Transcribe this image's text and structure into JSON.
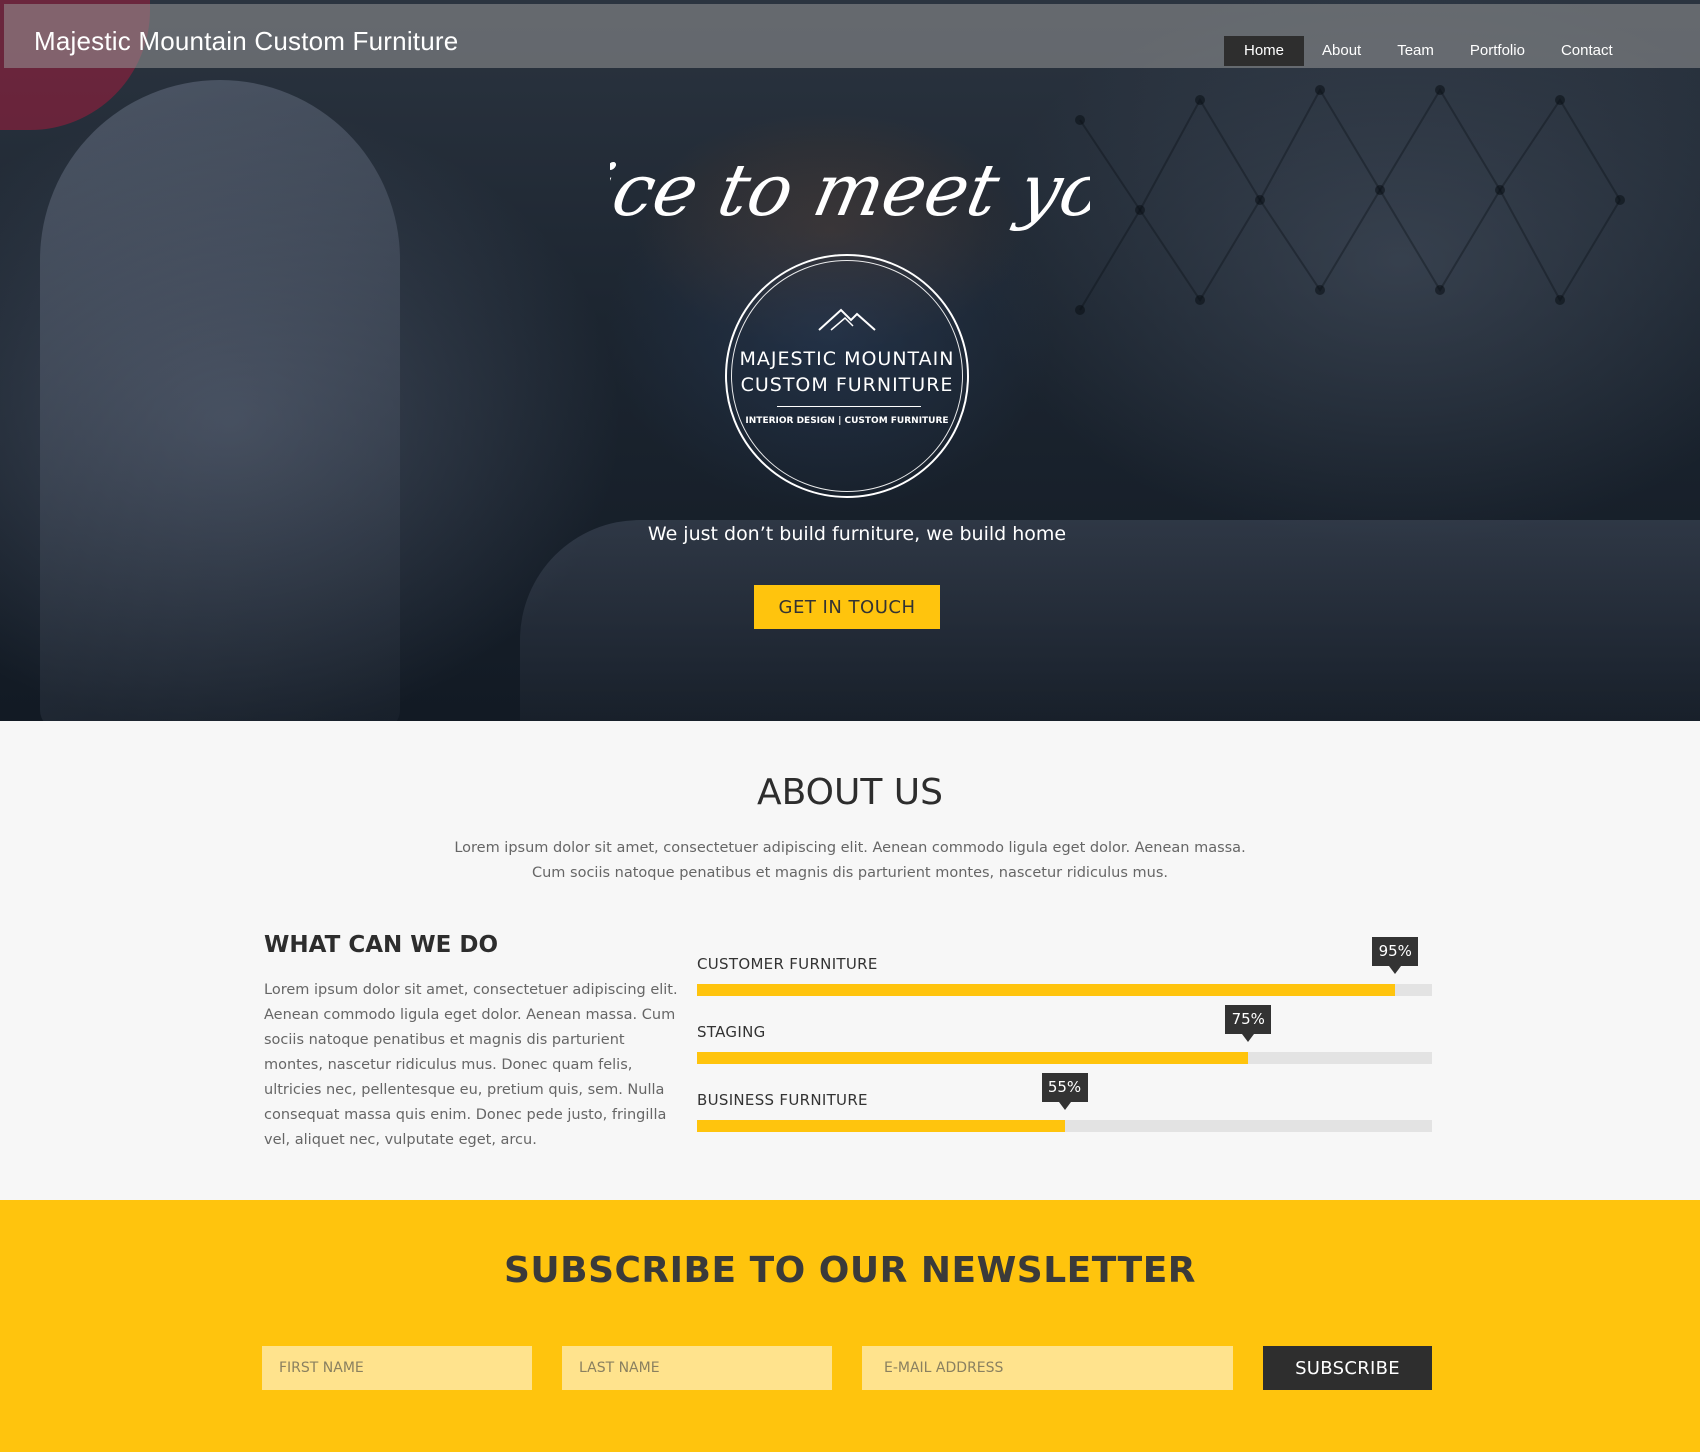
{
  "header": {
    "brand": "Majestic Mountain Custom Furniture",
    "nav": [
      {
        "label": "Home",
        "active": true
      },
      {
        "label": "About",
        "active": false
      },
      {
        "label": "Team",
        "active": false
      },
      {
        "label": "Portfolio",
        "active": false
      },
      {
        "label": "Contact",
        "active": false
      }
    ]
  },
  "hero": {
    "script_heading": "Nice to meet you!",
    "logo": {
      "line1": "MAJESTIC MOUNTAIN",
      "line2": "CUSTOM FURNITURE",
      "subline": "INTERIOR DESIGN | CUSTOM FURNITURE",
      "icon": "mountain-icon"
    },
    "tagline": "We just don’t build furniture, we build home",
    "cta_label": "GET IN TOUCH"
  },
  "about": {
    "title": "ABOUT US",
    "text": "Lorem ipsum dolor sit amet, consectetuer adipiscing elit. Aenean commodo ligula eget dolor. Aenean massa. Cum sociis natoque penatibus et magnis dis parturient montes, nascetur ridiculus mus.",
    "what_title": "WHAT CAN WE DO",
    "what_text": "Lorem ipsum dolor sit amet, consectetuer adipiscing elit. Aenean commodo ligula eget dolor. Aenean massa. Cum sociis natoque penatibus et magnis dis parturient montes, nascetur ridiculus mus. Donec quam felis, ultricies nec, pellentesque eu, pretium quis, sem. Nulla consequat massa quis enim. Donec pede justo, fringilla vel, aliquet nec, vulputate eget, arcu.",
    "skills": [
      {
        "label": "CUSTOMER FURNITURE",
        "percent": 95,
        "percent_label": "95%"
      },
      {
        "label": "STAGING",
        "percent": 75,
        "percent_label": "75%"
      },
      {
        "label": "BUSINESS FURNITURE",
        "percent": 50,
        "percent_label": "55%"
      }
    ]
  },
  "newsletter": {
    "title": "SUBSCRIBE TO OUR NEWSLETTER",
    "first_name_placeholder": "FIRST NAME",
    "last_name_placeholder": "LAST NAME",
    "email_placeholder": "E-MAIL ADDRESS",
    "subscribe_label": "SUBSCRIBE"
  },
  "colors": {
    "accent": "#ffc40d",
    "dark": "#2e2e2e",
    "input_bg": "#ffe38d"
  }
}
